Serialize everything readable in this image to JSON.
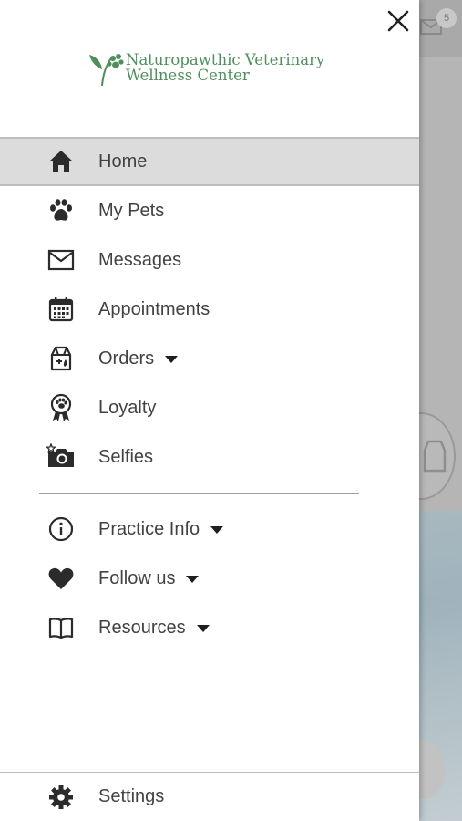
{
  "drawer": {
    "logo": {
      "line1": "Naturopawthic Veterinary",
      "line2": "Wellness Center"
    },
    "items": [
      {
        "label": "Home",
        "icon": "home-icon",
        "active": true,
        "has_caret": false
      },
      {
        "label": "My Pets",
        "icon": "paw-icon",
        "active": false,
        "has_caret": false
      },
      {
        "label": "Messages",
        "icon": "envelope-icon",
        "active": false,
        "has_caret": false
      },
      {
        "label": "Appointments",
        "icon": "calendar-icon",
        "active": false,
        "has_caret": false
      },
      {
        "label": "Orders",
        "icon": "food-bag-icon",
        "active": false,
        "has_caret": true
      },
      {
        "label": "Loyalty",
        "icon": "award-ribbon-icon",
        "active": false,
        "has_caret": false
      },
      {
        "label": "Selfies",
        "icon": "camera-icon",
        "active": false,
        "has_caret": false
      }
    ],
    "items2": [
      {
        "label": "Practice Info",
        "icon": "info-icon",
        "has_caret": true
      },
      {
        "label": "Follow us",
        "icon": "heart-icon",
        "has_caret": true
      },
      {
        "label": "Resources",
        "icon": "book-icon",
        "has_caret": true
      }
    ],
    "settings": {
      "label": "Settings",
      "icon": "gear-icon"
    }
  },
  "background": {
    "badge_count": "5"
  },
  "colors": {
    "brand_green": "#4e8f5c",
    "active_bg": "#dcdcdc",
    "text": "#424242"
  }
}
